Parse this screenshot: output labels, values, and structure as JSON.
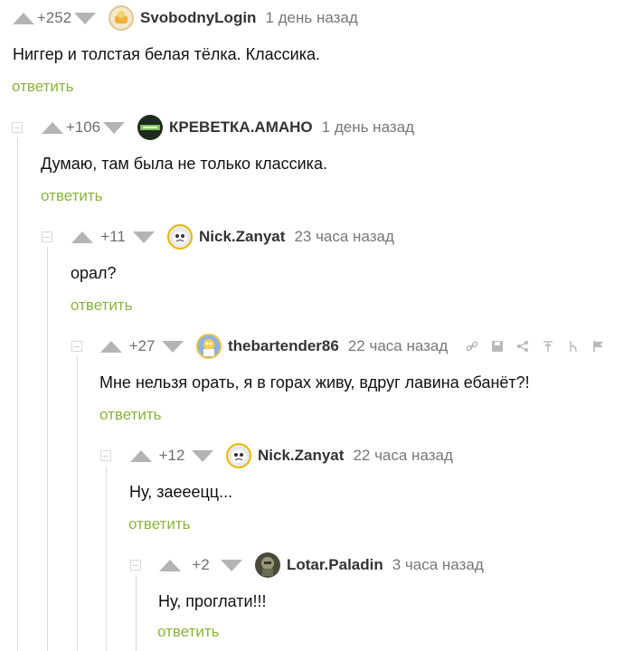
{
  "comments": [
    {
      "rating": "+252",
      "author": "SvobodnyLogin",
      "time": "1 день назад",
      "text": "Ниггер и толстая белая тёлка. Классика.",
      "reply": "ответить"
    },
    {
      "rating": "+106",
      "author": "КРЕВЕТКА.АМАНО",
      "time": "1 день назад",
      "text": "Думаю, там была не только классика.",
      "reply": "ответить"
    },
    {
      "rating": "+11",
      "author": "Nick.Zanyat",
      "time": "23 часа назад",
      "text": "орал?",
      "reply": "ответить"
    },
    {
      "rating": "+27",
      "author": "thebartender86",
      "time": "22 часа назад",
      "text": "Мне нельзя орать, я в горах живу, вдруг лавина ебанёт?!",
      "reply": "ответить"
    },
    {
      "rating": "+12",
      "author": "Nick.Zanyat",
      "time": "22 часа назад",
      "text": "Ну, заееецц...",
      "reply": "ответить"
    },
    {
      "rating": "+2",
      "author": "Lotar.Paladin",
      "time": "3 часа назад",
      "text": "Ну, проглати!!!",
      "reply": "ответить"
    }
  ],
  "colors": {
    "reply_link": "#8ab33d",
    "vote_arrow": "#b4b4b4",
    "thread_line": "#dcdcdc"
  },
  "icons": {
    "vote_up": "triangle-up-icon",
    "vote_down": "triangle-down-icon",
    "tools": [
      "link-icon",
      "save-icon",
      "share-icon",
      "parent-comment-icon",
      "branch-icon",
      "report-flag-icon"
    ]
  }
}
